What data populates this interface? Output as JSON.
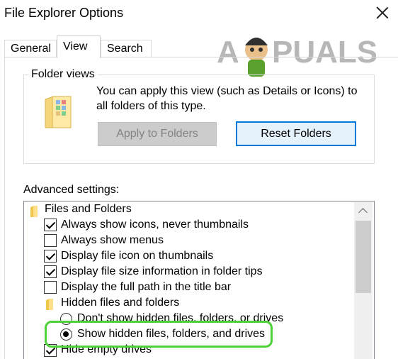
{
  "window": {
    "title": "File Explorer Options"
  },
  "tabs": [
    {
      "label": "General"
    },
    {
      "label": "View"
    },
    {
      "label": "Search"
    }
  ],
  "watermark": {
    "text": "A PUALS"
  },
  "folder_views": {
    "label": "Folder views",
    "description": "You can apply this view (such as Details or Icons) to all folders of this type.",
    "apply_button": "Apply to Folders",
    "reset_button": "Reset Folders"
  },
  "advanced": {
    "label": "Advanced settings:",
    "items": [
      {
        "type": "folder",
        "label": "Files and Folders"
      },
      {
        "type": "checkbox",
        "checked": true,
        "label": "Always show icons, never thumbnails"
      },
      {
        "type": "checkbox",
        "checked": false,
        "label": "Always show menus"
      },
      {
        "type": "checkbox",
        "checked": true,
        "label": "Display file icon on thumbnails"
      },
      {
        "type": "checkbox",
        "checked": true,
        "label": "Display file size information in folder tips"
      },
      {
        "type": "checkbox",
        "checked": false,
        "label": "Display the full path in the title bar"
      },
      {
        "type": "folder",
        "label": "Hidden files and folders"
      },
      {
        "type": "radio",
        "selected": false,
        "label": "Don't show hidden files, folders, or drives"
      },
      {
        "type": "radio",
        "selected": true,
        "label": "Show hidden files, folders, and drives"
      },
      {
        "type": "checkbox",
        "checked": true,
        "label": "Hide empty drives"
      }
    ]
  },
  "colors": {
    "highlight": "#4cd137",
    "focus_border": "#0078d7"
  }
}
